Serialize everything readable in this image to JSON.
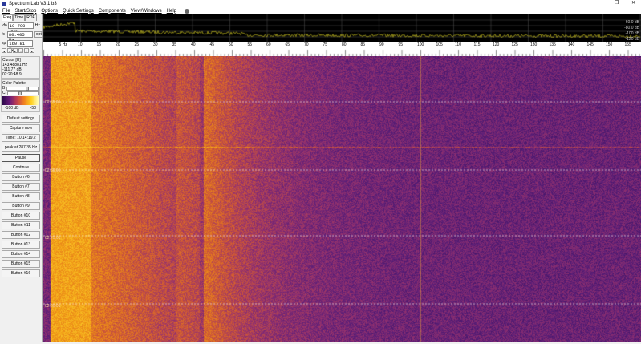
{
  "window": {
    "title": "Spectrum Lab V3.1 b3",
    "minimize": "–",
    "restore": "❐",
    "close": "✕"
  },
  "menu": [
    "File",
    "Start/Stop",
    "Options",
    "Quick Settings",
    "Components",
    "View/Windows",
    "Help"
  ],
  "tabs": [
    "Freq",
    "Time",
    "RDF"
  ],
  "vfo": {
    "label": "vfo",
    "value": "10 700 000",
    "unit": "Hz"
  },
  "fc": {
    "label": "fc",
    "value": "80.405 Hz",
    "button": "opt"
  },
  "sp": {
    "label": "sp",
    "value": "160.81 Hz"
  },
  "cursor": {
    "title": "Cursor [H]",
    "freq": "143.48881 Hz",
    "level": "-111.77 dB",
    "time": "02:20:48.9"
  },
  "palette": {
    "title": "Color Palette",
    "b": "B",
    "c": "C",
    "min": "-100 dB",
    "max": "-50"
  },
  "buttons": [
    "Default settings",
    "Capture now",
    "Time: 10:14:19.2",
    "peak at 287.35 Hz",
    "Pause",
    "Continue",
    "Button #6",
    "Button #7",
    "Button #8",
    "Button #9",
    "Button #10",
    "Button #11",
    "Button #12",
    "Button #13",
    "Button #14",
    "Button #15",
    "Button #16"
  ],
  "db_labels": [
    "-60.0 dB",
    "-80.0 dB",
    "-100 dB",
    "-120 dB"
  ],
  "freq_ticks": [
    "5 Hz",
    "10",
    "15",
    "20",
    "25",
    "30",
    "35",
    "40",
    "45",
    "50",
    "55",
    "60",
    "65",
    "70",
    "75",
    "80",
    "85",
    "90",
    "95",
    "100",
    "105",
    "110",
    "115",
    "120",
    "125",
    "130",
    "135",
    "140",
    "145",
    "150",
    "155"
  ],
  "timestamps": [
    "02:35:00",
    "02:30:00",
    "02:25:01",
    "02:20:01"
  ]
}
